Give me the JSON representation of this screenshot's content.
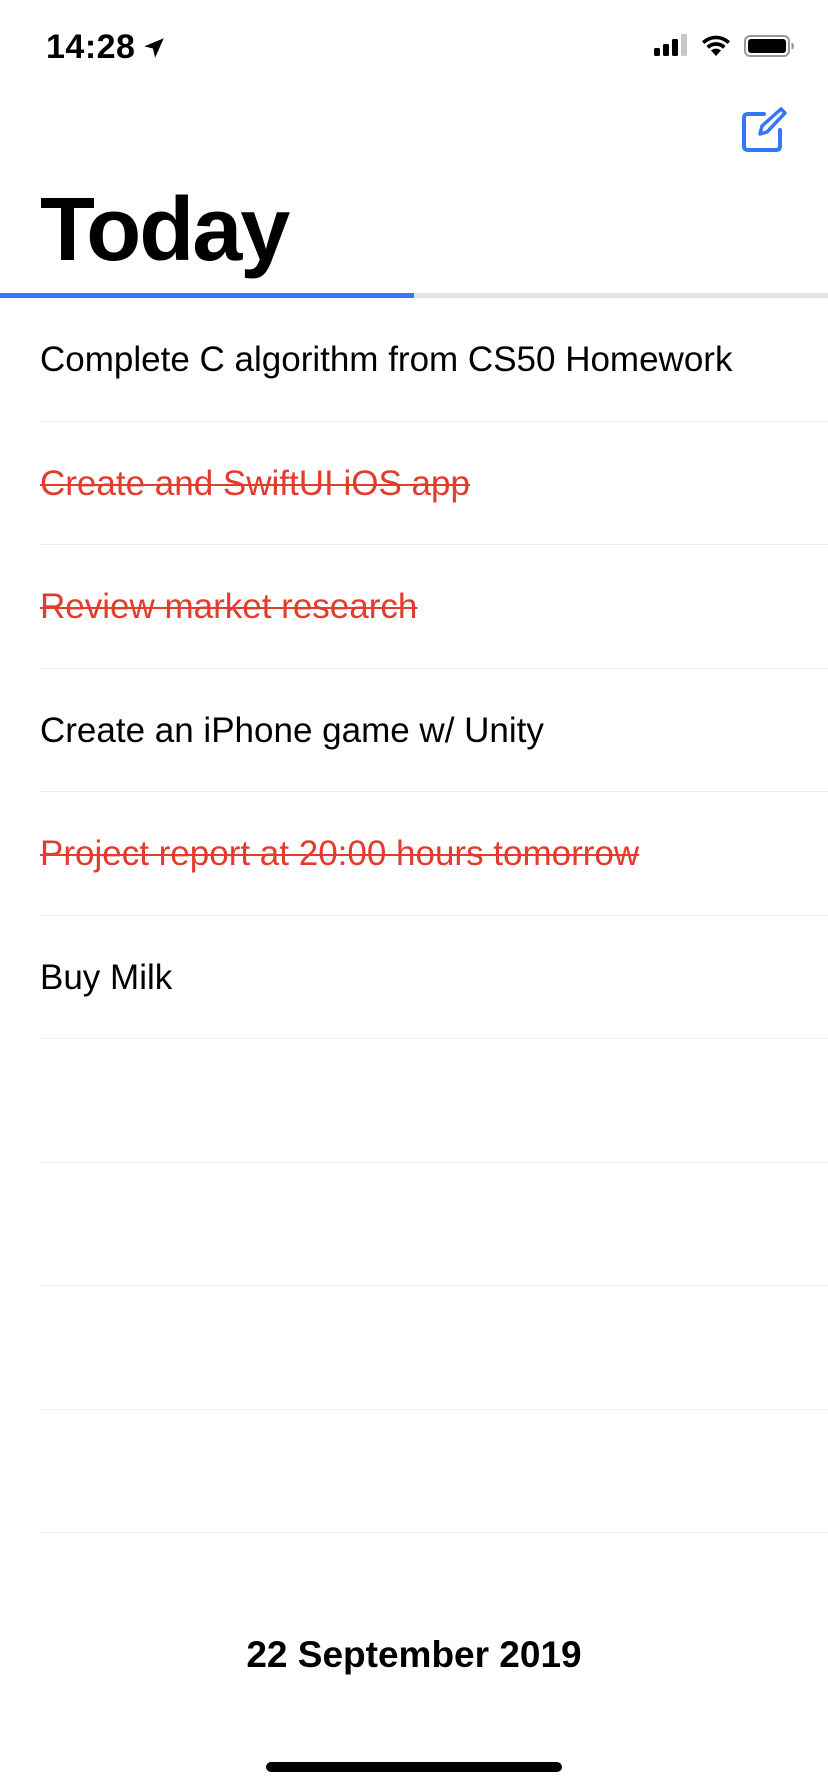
{
  "status_bar": {
    "time": "14:28",
    "location_icon": "location-arrow-icon",
    "signal_icon": "cellular-signal-icon",
    "wifi_icon": "wifi-icon",
    "battery_icon": "battery-icon"
  },
  "header": {
    "compose_icon": "compose-icon",
    "title": "Today"
  },
  "progress": {
    "completed_fraction": 0.5,
    "fill_color": "#3478f6",
    "track_color": "#e4e4e6"
  },
  "colors": {
    "done_text": "#e33b2c",
    "accent": "#3478f6"
  },
  "tasks": [
    {
      "text": "Complete C algorithm from CS50 Homework",
      "done": false
    },
    {
      "text": "Create and SwiftUI iOS app",
      "done": true
    },
    {
      "text": "Review market research",
      "done": true
    },
    {
      "text": "Create an iPhone game w/ Unity",
      "done": false
    },
    {
      "text": "Project report at 20:00 hours tomorrow",
      "done": true
    },
    {
      "text": "Buy Milk",
      "done": false
    },
    {
      "text": "",
      "done": false
    },
    {
      "text": "",
      "done": false
    },
    {
      "text": "",
      "done": false
    },
    {
      "text": "",
      "done": false
    }
  ],
  "footer": {
    "date": "22 September 2019"
  }
}
